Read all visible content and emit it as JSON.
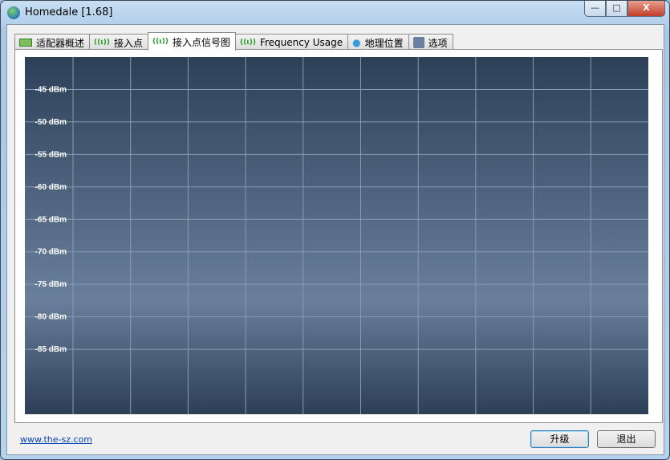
{
  "window": {
    "title": "Homedale [1.68]",
    "minimize": "—",
    "maximize": "□",
    "close": "X"
  },
  "tabs": [
    {
      "label": "适配器概述",
      "icon": "adapter-icon"
    },
    {
      "label": "接入点",
      "icon": "antenna-icon"
    },
    {
      "label": "接入点信号图",
      "icon": "antenna-icon",
      "active": true
    },
    {
      "label": "Frequency Usage",
      "icon": "antenna-icon"
    },
    {
      "label": "地理位置",
      "icon": "location-pin-icon"
    },
    {
      "label": "选项",
      "icon": "settings-icon"
    }
  ],
  "chart_data": {
    "type": "line",
    "series": [],
    "y_ticks": [
      "-45 dBm",
      "-50 dBm",
      "-55 dBm",
      "-60 dBm",
      "-65 dBm",
      "-70 dBm",
      "-75 dBm",
      "-80 dBm",
      "-85 dBm"
    ],
    "ylim": [
      -95,
      -40
    ],
    "x_gridlines": 10,
    "grid": true
  },
  "footer": {
    "link": "www.the-sz.com",
    "upgrade": "升级",
    "exit": "退出"
  }
}
